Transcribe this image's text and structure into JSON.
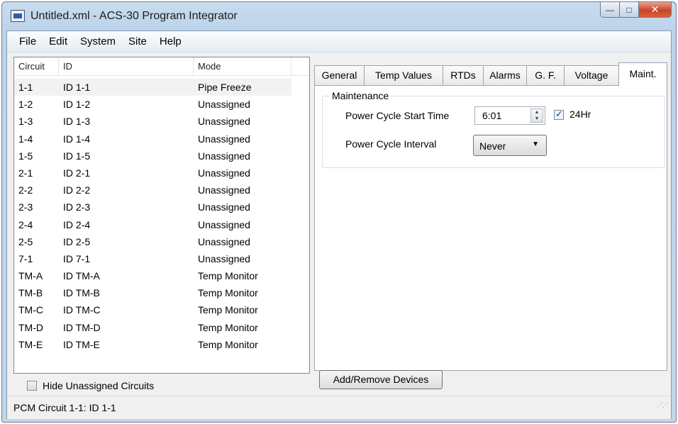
{
  "window": {
    "title": "Untitled.xml - ACS-30 Program Integrator",
    "min_glyph": "—",
    "max_glyph": "□",
    "close_glyph": "✕"
  },
  "menu": [
    "File",
    "Edit",
    "System",
    "Site",
    "Help"
  ],
  "circuit_list": {
    "columns": [
      "Circuit",
      "ID",
      "Mode"
    ],
    "rows": [
      {
        "circuit": "1-1",
        "id": "ID 1-1",
        "mode": "Pipe Freeze"
      },
      {
        "circuit": "1-2",
        "id": "ID 1-2",
        "mode": "Unassigned"
      },
      {
        "circuit": "1-3",
        "id": "ID 1-3",
        "mode": "Unassigned"
      },
      {
        "circuit": "1-4",
        "id": "ID 1-4",
        "mode": "Unassigned"
      },
      {
        "circuit": "1-5",
        "id": "ID 1-5",
        "mode": "Unassigned"
      },
      {
        "circuit": "2-1",
        "id": "ID 2-1",
        "mode": "Unassigned"
      },
      {
        "circuit": "2-2",
        "id": "ID 2-2",
        "mode": "Unassigned"
      },
      {
        "circuit": "2-3",
        "id": "ID 2-3",
        "mode": "Unassigned"
      },
      {
        "circuit": "2-4",
        "id": "ID 2-4",
        "mode": "Unassigned"
      },
      {
        "circuit": "2-5",
        "id": "ID 2-5",
        "mode": "Unassigned"
      },
      {
        "circuit": "7-1",
        "id": "ID 7-1",
        "mode": "Unassigned"
      },
      {
        "circuit": "TM-A",
        "id": "ID TM-A",
        "mode": "Temp Monitor"
      },
      {
        "circuit": "TM-B",
        "id": "ID TM-B",
        "mode": "Temp Monitor"
      },
      {
        "circuit": "TM-C",
        "id": "ID TM-C",
        "mode": "Temp Monitor"
      },
      {
        "circuit": "TM-D",
        "id": "ID TM-D",
        "mode": "Temp Monitor"
      },
      {
        "circuit": "TM-E",
        "id": "ID TM-E",
        "mode": "Temp Monitor"
      }
    ],
    "selected_index": 0
  },
  "hide_unassigned": {
    "label": "Hide Unassigned Circuits",
    "checked": false
  },
  "tabs": {
    "items": [
      "General",
      "Temp Values",
      "RTDs",
      "Alarms",
      "G. F.",
      "Voltage",
      "Maint."
    ],
    "active": "Maint."
  },
  "maintenance": {
    "group_label": "Maintenance",
    "start_time_label": "Power Cycle Start Time",
    "start_time_value": "6:01",
    "h24_label": "24Hr",
    "h24_checked": true,
    "interval_label": "Power Cycle Interval",
    "interval_value": "Never"
  },
  "add_remove_button": "Add/Remove Devices",
  "status": {
    "text": "PCM Circuit 1-1: ID 1-1"
  }
}
